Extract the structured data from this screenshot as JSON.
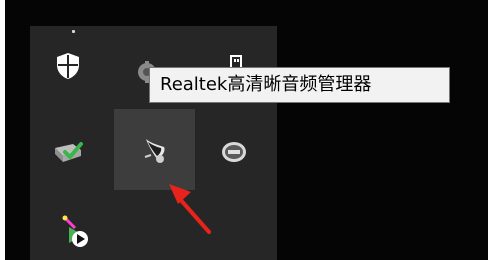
{
  "tooltip": {
    "text": "Realtek高清晰音频管理器"
  },
  "tray_icons": [
    {
      "name": "windows-security-shield-icon",
      "hovered": false
    },
    {
      "name": "gear-settings-icon",
      "hovered": false
    },
    {
      "name": "usb-device-icon",
      "hovered": false
    },
    {
      "name": "safely-remove-hardware-icon",
      "hovered": false
    },
    {
      "name": "realtek-audio-manager-icon",
      "hovered": true
    },
    {
      "name": "esi-app-icon",
      "hovered": false
    },
    {
      "name": "media-player-icon",
      "hovered": false
    }
  ],
  "colors": {
    "taskbar": "#050505",
    "panel": "#262626",
    "hover": "#3d3d3d",
    "tooltip_bg": "#f2f2f2",
    "arrow": "#e8231b"
  },
  "annotation": {
    "arrow_icon": "red-arrow-icon"
  }
}
